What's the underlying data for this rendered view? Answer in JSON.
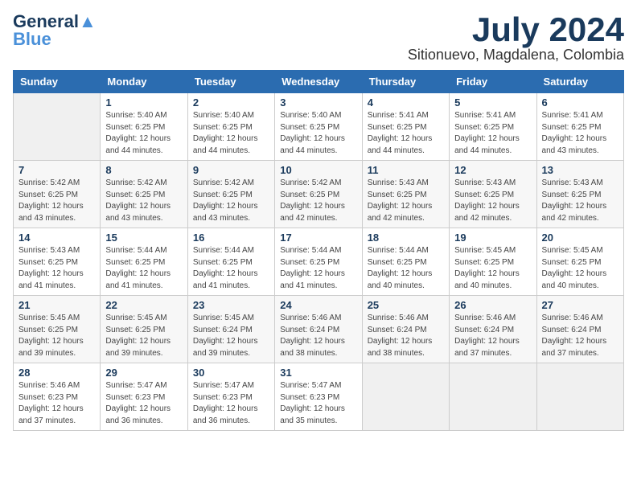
{
  "logo": {
    "line1": "General",
    "line2": "Blue",
    "tagline": ""
  },
  "header": {
    "month_year": "July 2024",
    "location": "Sitionuevo, Magdalena, Colombia"
  },
  "weekdays": [
    "Sunday",
    "Monday",
    "Tuesday",
    "Wednesday",
    "Thursday",
    "Friday",
    "Saturday"
  ],
  "weeks": [
    [
      {
        "day": "",
        "info": ""
      },
      {
        "day": "1",
        "info": "Sunrise: 5:40 AM\nSunset: 6:25 PM\nDaylight: 12 hours\nand 44 minutes."
      },
      {
        "day": "2",
        "info": "Sunrise: 5:40 AM\nSunset: 6:25 PM\nDaylight: 12 hours\nand 44 minutes."
      },
      {
        "day": "3",
        "info": "Sunrise: 5:40 AM\nSunset: 6:25 PM\nDaylight: 12 hours\nand 44 minutes."
      },
      {
        "day": "4",
        "info": "Sunrise: 5:41 AM\nSunset: 6:25 PM\nDaylight: 12 hours\nand 44 minutes."
      },
      {
        "day": "5",
        "info": "Sunrise: 5:41 AM\nSunset: 6:25 PM\nDaylight: 12 hours\nand 44 minutes."
      },
      {
        "day": "6",
        "info": "Sunrise: 5:41 AM\nSunset: 6:25 PM\nDaylight: 12 hours\nand 43 minutes."
      }
    ],
    [
      {
        "day": "7",
        "info": "Sunrise: 5:42 AM\nSunset: 6:25 PM\nDaylight: 12 hours\nand 43 minutes."
      },
      {
        "day": "8",
        "info": "Sunrise: 5:42 AM\nSunset: 6:25 PM\nDaylight: 12 hours\nand 43 minutes."
      },
      {
        "day": "9",
        "info": "Sunrise: 5:42 AM\nSunset: 6:25 PM\nDaylight: 12 hours\nand 43 minutes."
      },
      {
        "day": "10",
        "info": "Sunrise: 5:42 AM\nSunset: 6:25 PM\nDaylight: 12 hours\nand 42 minutes."
      },
      {
        "day": "11",
        "info": "Sunrise: 5:43 AM\nSunset: 6:25 PM\nDaylight: 12 hours\nand 42 minutes."
      },
      {
        "day": "12",
        "info": "Sunrise: 5:43 AM\nSunset: 6:25 PM\nDaylight: 12 hours\nand 42 minutes."
      },
      {
        "day": "13",
        "info": "Sunrise: 5:43 AM\nSunset: 6:25 PM\nDaylight: 12 hours\nand 42 minutes."
      }
    ],
    [
      {
        "day": "14",
        "info": "Sunrise: 5:43 AM\nSunset: 6:25 PM\nDaylight: 12 hours\nand 41 minutes."
      },
      {
        "day": "15",
        "info": "Sunrise: 5:44 AM\nSunset: 6:25 PM\nDaylight: 12 hours\nand 41 minutes."
      },
      {
        "day": "16",
        "info": "Sunrise: 5:44 AM\nSunset: 6:25 PM\nDaylight: 12 hours\nand 41 minutes."
      },
      {
        "day": "17",
        "info": "Sunrise: 5:44 AM\nSunset: 6:25 PM\nDaylight: 12 hours\nand 41 minutes."
      },
      {
        "day": "18",
        "info": "Sunrise: 5:44 AM\nSunset: 6:25 PM\nDaylight: 12 hours\nand 40 minutes."
      },
      {
        "day": "19",
        "info": "Sunrise: 5:45 AM\nSunset: 6:25 PM\nDaylight: 12 hours\nand 40 minutes."
      },
      {
        "day": "20",
        "info": "Sunrise: 5:45 AM\nSunset: 6:25 PM\nDaylight: 12 hours\nand 40 minutes."
      }
    ],
    [
      {
        "day": "21",
        "info": "Sunrise: 5:45 AM\nSunset: 6:25 PM\nDaylight: 12 hours\nand 39 minutes."
      },
      {
        "day": "22",
        "info": "Sunrise: 5:45 AM\nSunset: 6:25 PM\nDaylight: 12 hours\nand 39 minutes."
      },
      {
        "day": "23",
        "info": "Sunrise: 5:45 AM\nSunset: 6:24 PM\nDaylight: 12 hours\nand 39 minutes."
      },
      {
        "day": "24",
        "info": "Sunrise: 5:46 AM\nSunset: 6:24 PM\nDaylight: 12 hours\nand 38 minutes."
      },
      {
        "day": "25",
        "info": "Sunrise: 5:46 AM\nSunset: 6:24 PM\nDaylight: 12 hours\nand 38 minutes."
      },
      {
        "day": "26",
        "info": "Sunrise: 5:46 AM\nSunset: 6:24 PM\nDaylight: 12 hours\nand 37 minutes."
      },
      {
        "day": "27",
        "info": "Sunrise: 5:46 AM\nSunset: 6:24 PM\nDaylight: 12 hours\nand 37 minutes."
      }
    ],
    [
      {
        "day": "28",
        "info": "Sunrise: 5:46 AM\nSunset: 6:23 PM\nDaylight: 12 hours\nand 37 minutes."
      },
      {
        "day": "29",
        "info": "Sunrise: 5:47 AM\nSunset: 6:23 PM\nDaylight: 12 hours\nand 36 minutes."
      },
      {
        "day": "30",
        "info": "Sunrise: 5:47 AM\nSunset: 6:23 PM\nDaylight: 12 hours\nand 36 minutes."
      },
      {
        "day": "31",
        "info": "Sunrise: 5:47 AM\nSunset: 6:23 PM\nDaylight: 12 hours\nand 35 minutes."
      },
      {
        "day": "",
        "info": ""
      },
      {
        "day": "",
        "info": ""
      },
      {
        "day": "",
        "info": ""
      }
    ]
  ]
}
